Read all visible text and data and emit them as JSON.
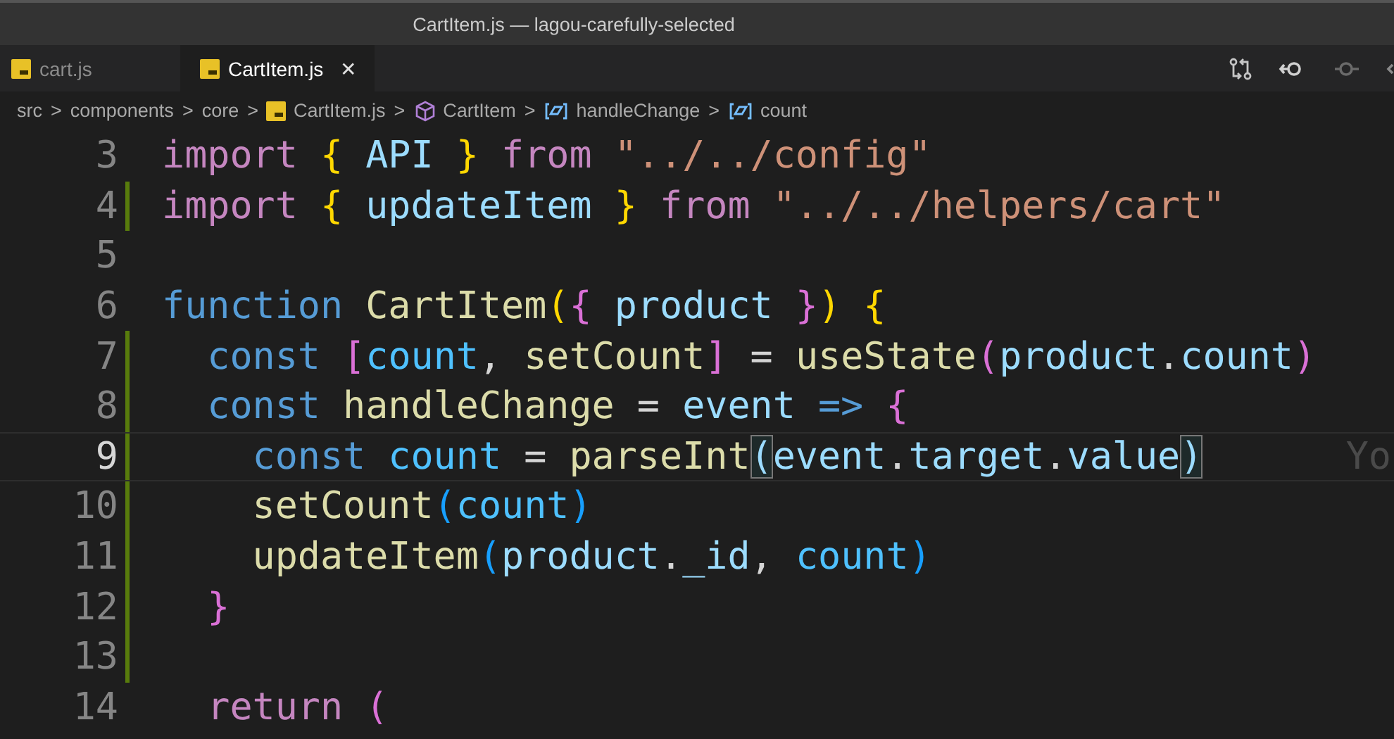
{
  "window": {
    "title": "CartItem.js — lagou-carefully-selected"
  },
  "tabs": [
    {
      "label": "cart.js",
      "selected": false
    },
    {
      "label": "CartItem.js",
      "selected": true,
      "close": "✕"
    }
  ],
  "breadcrumb": [
    {
      "label": "src",
      "kind": "folder"
    },
    {
      "label": "components",
      "kind": "folder"
    },
    {
      "label": "core",
      "kind": "folder"
    },
    {
      "label": "CartItem.js",
      "kind": "file"
    },
    {
      "label": "CartItem",
      "kind": "component"
    },
    {
      "label": "handleChange",
      "kind": "variable"
    },
    {
      "label": "count",
      "kind": "variable"
    }
  ],
  "breadcrumb_separator": ">",
  "lines": [
    {
      "number": "3",
      "changed": false,
      "current": false,
      "tokens": [
        {
          "text": "import",
          "kind": "keyword"
        },
        {
          "text": " {",
          "kind": "brace1"
        },
        {
          "text": " API",
          "kind": "variable"
        },
        {
          "text": " }",
          "kind": "brace1"
        },
        {
          "text": " from",
          "kind": "keyword"
        },
        {
          "text": " \"../../config\"",
          "kind": "string"
        }
      ]
    },
    {
      "number": "4",
      "changed": true,
      "current": false,
      "tokens": [
        {
          "text": "import",
          "kind": "keyword"
        },
        {
          "text": " {",
          "kind": "brace1"
        },
        {
          "text": " updateItem",
          "kind": "variable"
        },
        {
          "text": " }",
          "kind": "brace1"
        },
        {
          "text": " from",
          "kind": "keyword"
        },
        {
          "text": " \"../../helpers/cart\"",
          "kind": "string"
        }
      ]
    },
    {
      "number": "5",
      "changed": false,
      "current": false
    },
    {
      "number": "6",
      "changed": false,
      "current": false,
      "tokens": [
        {
          "text": "function",
          "kind": "storage"
        },
        {
          "text": " CartItem",
          "kind": "func"
        },
        {
          "text": "(",
          "kind": "brace1"
        },
        {
          "text": "{",
          "kind": "brace2"
        },
        {
          "text": " product",
          "kind": "variable"
        },
        {
          "text": " }",
          "kind": "brace2"
        },
        {
          "text": ")",
          "kind": "brace1"
        },
        {
          "text": " {",
          "kind": "brace1"
        }
      ]
    },
    {
      "number": "7",
      "changed": true,
      "current": false,
      "tokens": [
        {
          "text": "  const",
          "kind": "storage"
        },
        {
          "text": " [",
          "kind": "brace2"
        },
        {
          "text": "count",
          "kind": "constant"
        },
        {
          "text": ",",
          "kind": "plain"
        },
        {
          "text": " setCount",
          "kind": "func"
        },
        {
          "text": "]",
          "kind": "brace2"
        },
        {
          "text": " =",
          "kind": "plain"
        },
        {
          "text": " useState",
          "kind": "func"
        },
        {
          "text": "(",
          "kind": "brace2"
        },
        {
          "text": "product",
          "kind": "variable"
        },
        {
          "text": ".",
          "kind": "plain"
        },
        {
          "text": "count",
          "kind": "variable"
        },
        {
          "text": ")",
          "kind": "brace2"
        }
      ]
    },
    {
      "number": "8",
      "changed": true,
      "current": false,
      "tokens": [
        {
          "text": "  const",
          "kind": "storage"
        },
        {
          "text": " handleChange",
          "kind": "func"
        },
        {
          "text": " =",
          "kind": "plain"
        },
        {
          "text": " event",
          "kind": "variable"
        },
        {
          "text": " =>",
          "kind": "storage"
        },
        {
          "text": " {",
          "kind": "brace2"
        }
      ]
    },
    {
      "number": "9",
      "changed": true,
      "current": true,
      "blame": "Yo",
      "tokens": [
        {
          "text": "    const",
          "kind": "storage"
        },
        {
          "text": " count",
          "kind": "constant"
        },
        {
          "text": " =",
          "kind": "plain"
        },
        {
          "text": " parseInt",
          "kind": "func"
        },
        {
          "text": "(",
          "kind": "match"
        },
        {
          "text": "event",
          "kind": "variable"
        },
        {
          "text": ".",
          "kind": "plain"
        },
        {
          "text": "target",
          "kind": "variable"
        },
        {
          "text": ".",
          "kind": "plain"
        },
        {
          "text": "value",
          "kind": "variable"
        },
        {
          "text": ")",
          "kind": "match"
        }
      ]
    },
    {
      "number": "10",
      "changed": true,
      "current": false,
      "tokens": [
        {
          "text": "    setCount",
          "kind": "func"
        },
        {
          "text": "(",
          "kind": "brace3"
        },
        {
          "text": "count",
          "kind": "constant"
        },
        {
          "text": ")",
          "kind": "brace3"
        }
      ]
    },
    {
      "number": "11",
      "changed": true,
      "current": false,
      "tokens": [
        {
          "text": "    updateItem",
          "kind": "func"
        },
        {
          "text": "(",
          "kind": "brace3"
        },
        {
          "text": "product",
          "kind": "variable"
        },
        {
          "text": ".",
          "kind": "plain"
        },
        {
          "text": "_id",
          "kind": "variable"
        },
        {
          "text": ",",
          "kind": "plain"
        },
        {
          "text": " count",
          "kind": "constant"
        },
        {
          "text": ")",
          "kind": "brace3"
        }
      ]
    },
    {
      "number": "12",
      "changed": true,
      "current": false,
      "tokens": [
        {
          "text": "  }",
          "kind": "brace2"
        }
      ]
    },
    {
      "number": "13",
      "changed": true,
      "current": false
    },
    {
      "number": "14",
      "changed": false,
      "current": false,
      "tokens": [
        {
          "text": "  return",
          "kind": "keyword"
        },
        {
          "text": " (",
          "kind": "brace2"
        }
      ]
    }
  ]
}
